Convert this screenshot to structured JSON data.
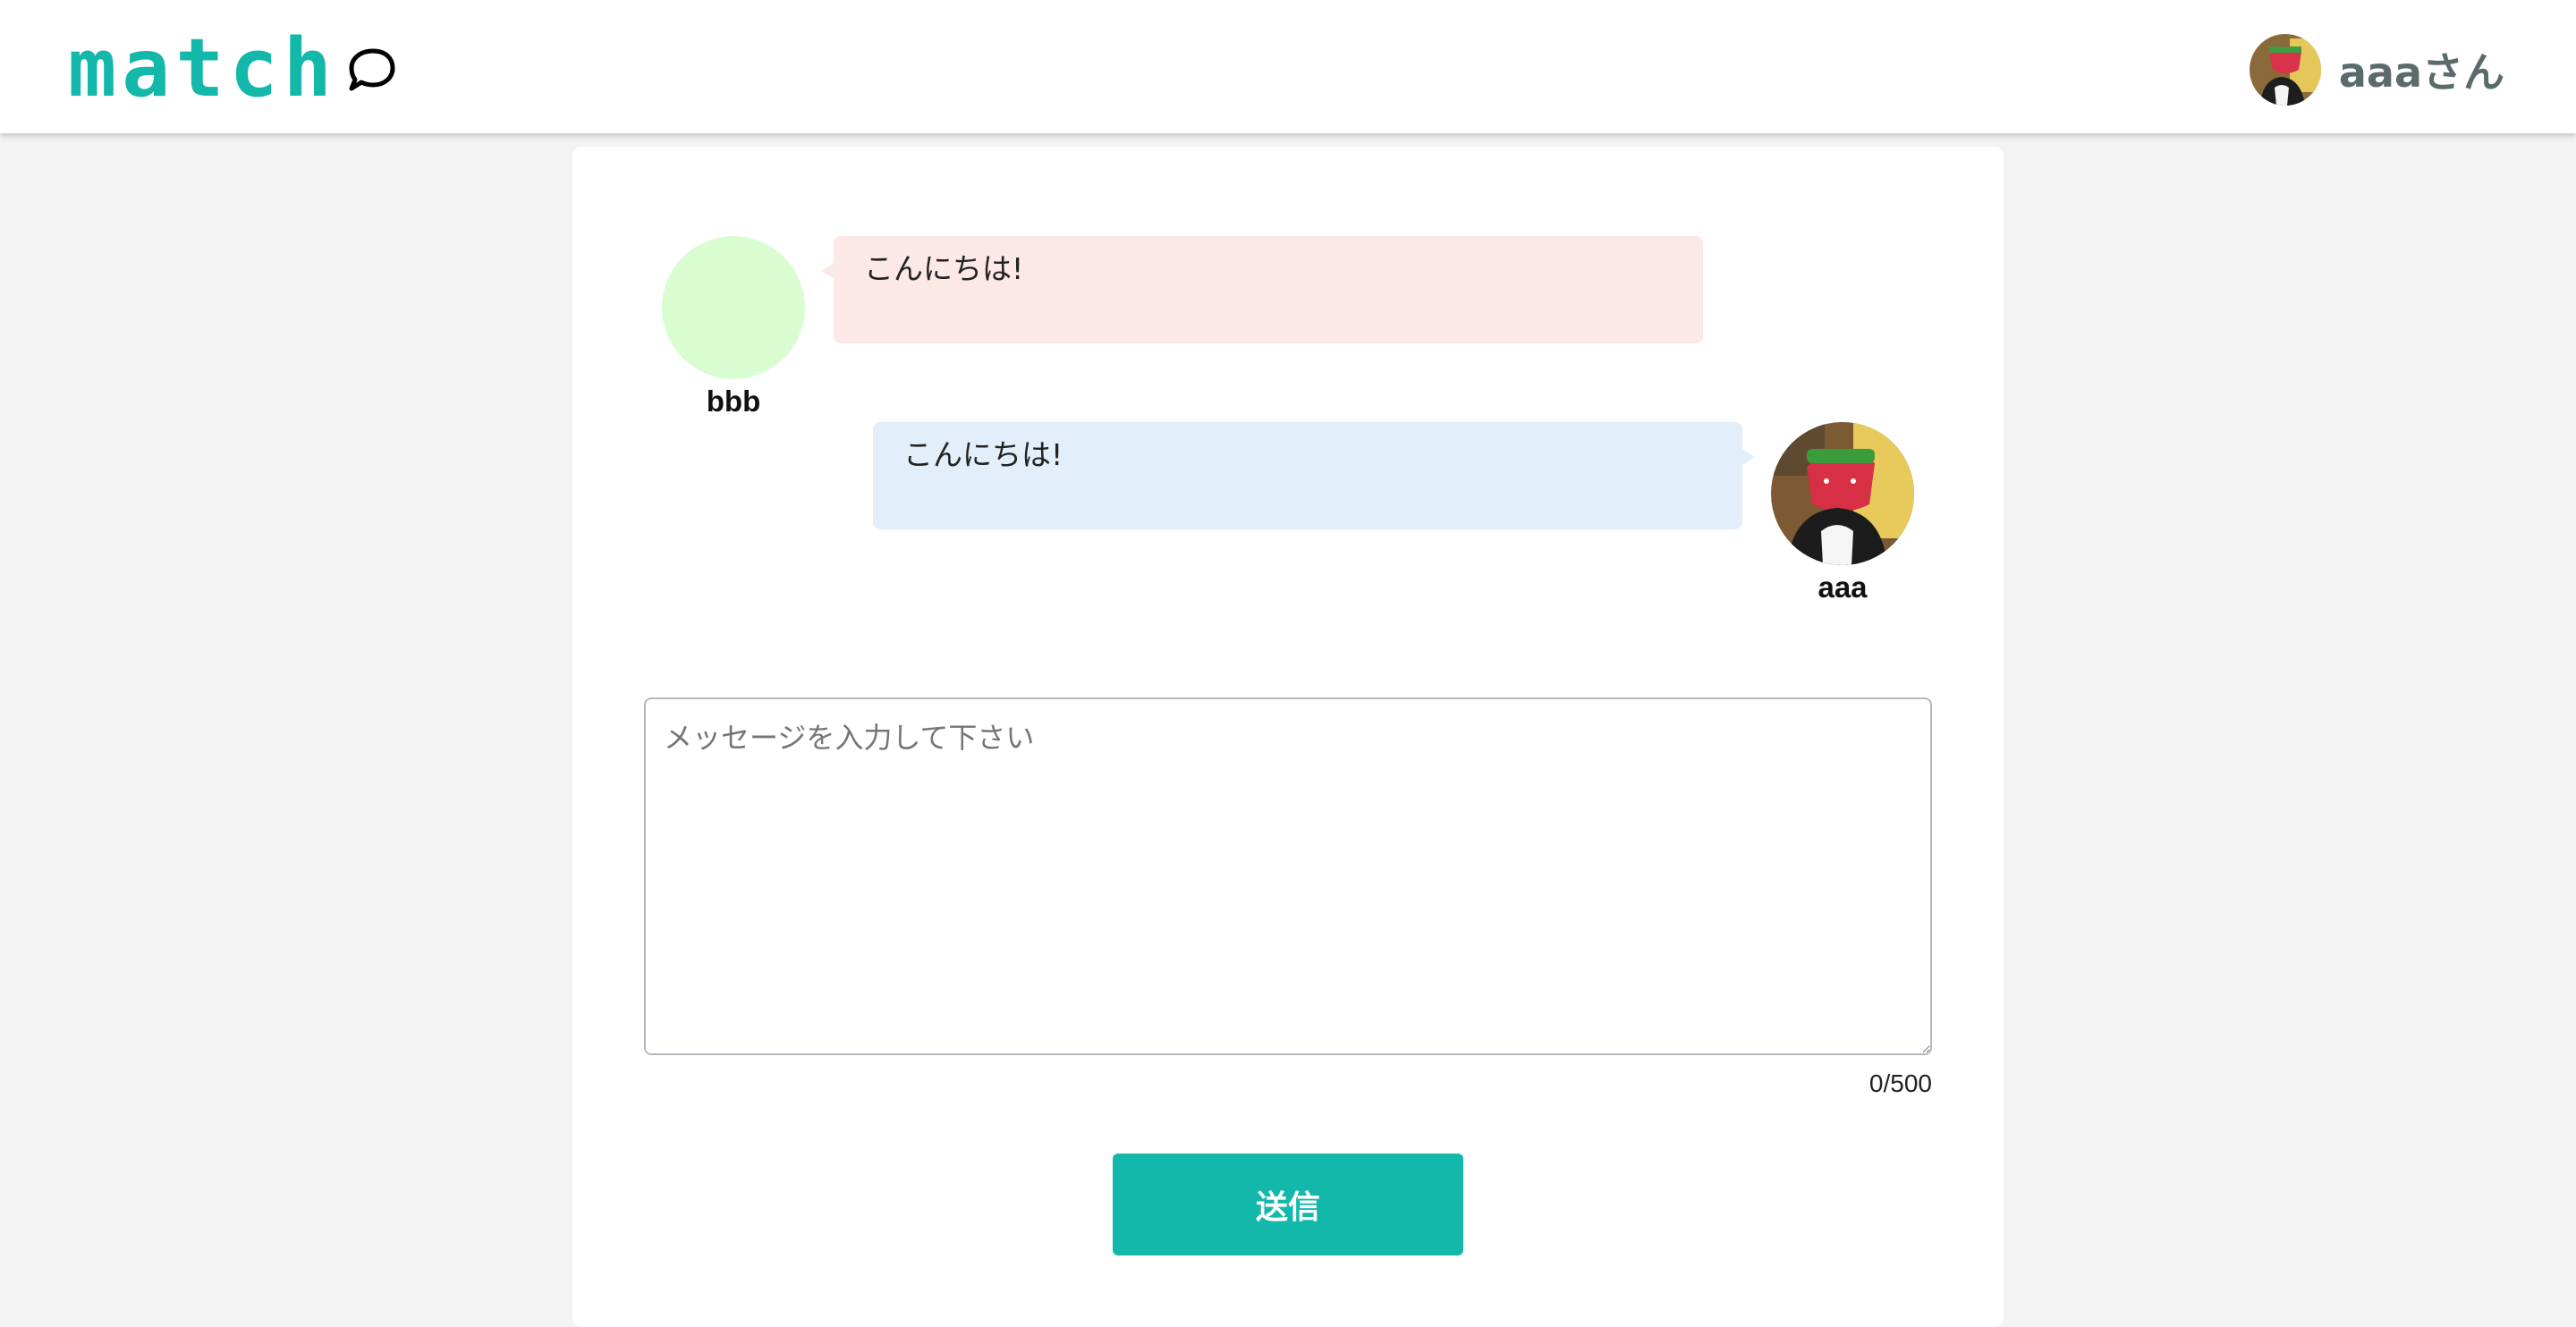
{
  "header": {
    "logo_text": "match",
    "logo_icon": "speech-bubble-icon",
    "user_name": "aaaさん",
    "accent_color": "#14b8aa"
  },
  "messages": [
    {
      "sender": "bbb",
      "text": "こんにちは!",
      "side": "left",
      "bubble_color": "#fbe8e7",
      "avatar": "placeholder-circle"
    },
    {
      "sender": "aaa",
      "text": "こんにちは!",
      "side": "right",
      "bubble_color": "#e2eefa",
      "avatar": "cat-photo"
    }
  ],
  "composer": {
    "placeholder": "メッセージを入力して下さい",
    "value": "",
    "counter": "0/500",
    "send_label": "送信"
  }
}
